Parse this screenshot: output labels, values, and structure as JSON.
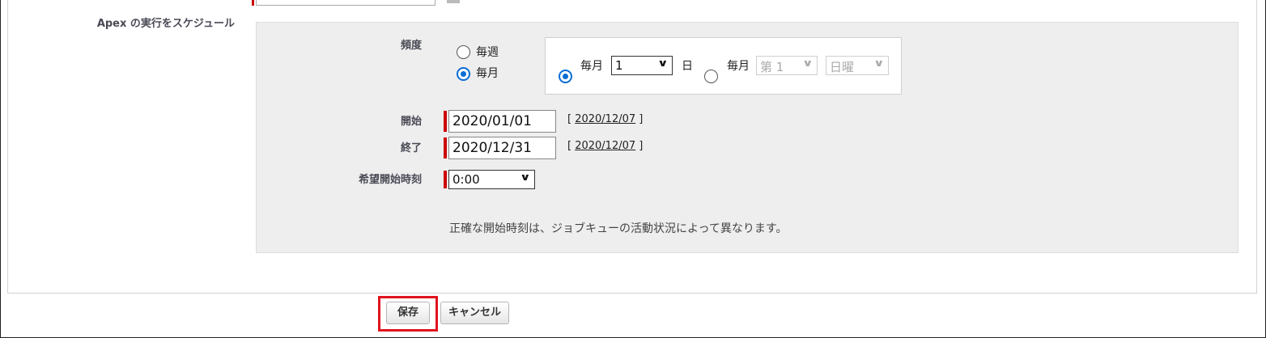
{
  "section": {
    "label": "Apex の実行をスケジュール"
  },
  "frequency": {
    "label": "頻度",
    "options": [
      {
        "label": "毎週",
        "checked": false
      },
      {
        "label": "毎月",
        "checked": true
      }
    ],
    "monthly": {
      "option1": {
        "prefix": "毎月",
        "day_value": "1",
        "suffix": "日",
        "checked": true
      },
      "option2": {
        "prefix": "毎月",
        "ordinal_value": "第 1",
        "weekday_value": "日曜",
        "checked": false
      }
    }
  },
  "start": {
    "label": "開始",
    "value": "2020/01/01",
    "today_link": "2020/12/07"
  },
  "end": {
    "label": "終了",
    "value": "2020/12/31",
    "today_link": "2020/12/07"
  },
  "preferred_time": {
    "label": "希望開始時刻",
    "value": "0:00"
  },
  "note": "正確な開始時刻は、ジョブキューの活動状況によって異なります。",
  "buttons": {
    "save": "保存",
    "cancel": "キャンセル"
  },
  "colors": {
    "required": "#cc0000",
    "radio_checked": "#0a6cd6",
    "highlight": "#e0141e",
    "panel_bg": "#eeeeee"
  }
}
